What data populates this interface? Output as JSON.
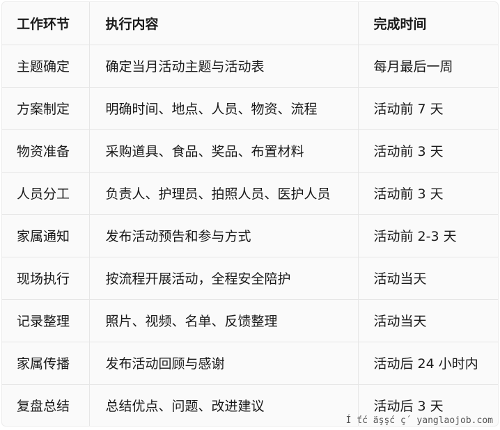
{
  "table": {
    "headers": [
      "工作环节",
      "执行内容",
      "完成时间"
    ],
    "rows": [
      [
        "主题确定",
        "确定当月活动主题与活动表",
        "每月最后一周"
      ],
      [
        "方案制定",
        "明确时间、地点、人员、物资、流程",
        "活动前 7 天"
      ],
      [
        "物资准备",
        "采购道具、食品、奖品、布置材料",
        "活动前 3 天"
      ],
      [
        "人员分工",
        "负责人、护理员、拍照人员、医护人员",
        "活动前 3 天"
      ],
      [
        "家属通知",
        "发布活动预告和参与方式",
        "活动前 2-3 天"
      ],
      [
        "现场执行",
        "按流程开展活动，全程安全陪护",
        "活动当天"
      ],
      [
        "记录整理",
        "照片、视频、名单、反馈整理",
        "活动当天"
      ],
      [
        "家属传播",
        "发布活动回顾与感谢",
        "活动后 24 小时内"
      ],
      [
        "复盘总结",
        "总结优点、问题、改进建议",
        "活动后 3 天"
      ]
    ]
  },
  "watermark": "Í ťć  äşşć  ç´  yanglaojob.com"
}
